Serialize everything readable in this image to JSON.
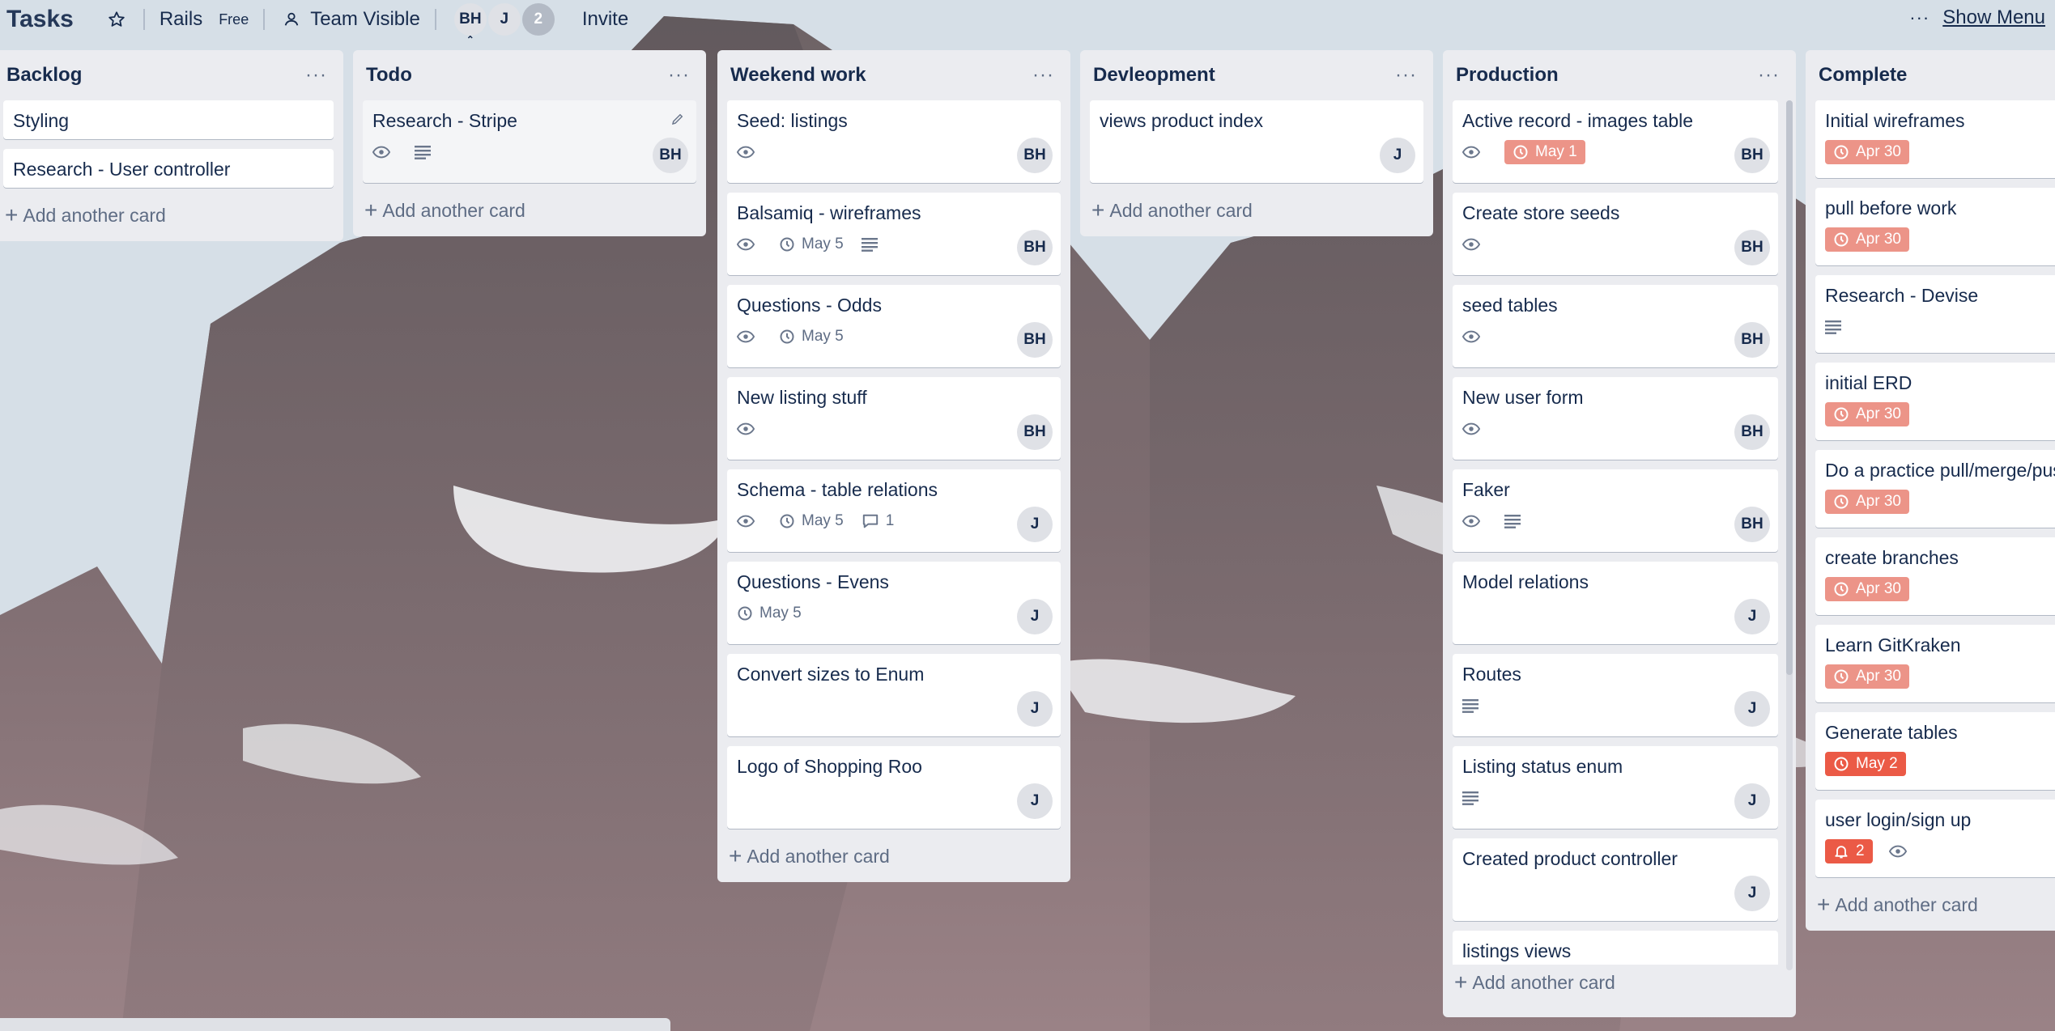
{
  "header": {
    "board_title": "Tasks",
    "team_name": "Rails",
    "team_plan": "Free",
    "visibility": "Team Visible",
    "members": [
      "BH",
      "J"
    ],
    "members_more": "2",
    "invite_label": "Invite",
    "show_menu_label": "Show Menu"
  },
  "lists": [
    {
      "title": "Backlog",
      "cards": [
        {
          "title": "Styling"
        },
        {
          "title": "Research - User controller"
        }
      ],
      "add_label": "Add another card"
    },
    {
      "title": "Todo",
      "cards": [
        {
          "title": "Research - Stripe",
          "watch": true,
          "description": true,
          "member": "BH"
        }
      ],
      "add_label": "Add another card"
    },
    {
      "title": "Weekend work",
      "cards": [
        {
          "title": "Seed: listings",
          "watch": true,
          "member": "BH"
        },
        {
          "title": "Balsamiq - wireframes",
          "watch": true,
          "due": "May 5",
          "description": true,
          "member": "BH"
        },
        {
          "title": "Questions - Odds",
          "watch": true,
          "due": "May 5",
          "member": "BH"
        },
        {
          "title": "New listing stuff",
          "watch": true,
          "member": "BH"
        },
        {
          "title": "Schema - table relations",
          "watch": true,
          "due": "May 5",
          "comments": "1",
          "member": "J"
        },
        {
          "title": "Questions - Evens",
          "due": "May 5",
          "member": "J"
        },
        {
          "title": "Convert sizes to Enum",
          "member": "J"
        },
        {
          "title": "Logo of Shopping Roo",
          "member": "J"
        }
      ],
      "add_label": "Add another card"
    },
    {
      "title": "Devleopment",
      "cards": [
        {
          "title": "views product index",
          "member": "J"
        }
      ],
      "add_label": "Add another card"
    },
    {
      "title": "Production",
      "cards": [
        {
          "title": "Active record - images table",
          "watch": true,
          "due_badge": "May 1",
          "member": "BH"
        },
        {
          "title": "Create store seeds",
          "watch": true,
          "member": "BH"
        },
        {
          "title": "seed tables",
          "watch": true,
          "member": "BH"
        },
        {
          "title": "New user form",
          "watch": true,
          "member": "BH"
        },
        {
          "title": "Faker",
          "watch": true,
          "description": true,
          "member": "BH"
        },
        {
          "title": "Model relations",
          "member": "J"
        },
        {
          "title": "Routes",
          "description": true,
          "member": "J"
        },
        {
          "title": "Listing status enum",
          "description": true,
          "member": "J"
        },
        {
          "title": "Created product controller",
          "member": "J"
        },
        {
          "title": "listings views"
        }
      ],
      "add_label": "Add another card"
    },
    {
      "title": "Complete",
      "cards": [
        {
          "title": "Initial wireframes",
          "due_badge": "Apr 30"
        },
        {
          "title": "pull before work",
          "due_badge": "Apr 30"
        },
        {
          "title": "Research - Devise",
          "description": true
        },
        {
          "title": "initial ERD",
          "due_badge": "Apr 30"
        },
        {
          "title": "Do a practice pull/merge/push",
          "due_badge": "Apr 30"
        },
        {
          "title": "create branches",
          "due_badge": "Apr 30"
        },
        {
          "title": "Learn GitKraken",
          "due_badge": "Apr 30"
        },
        {
          "title": "Generate tables",
          "due_badge_over": "May 2"
        },
        {
          "title": "user login/sign up",
          "notifications": "2",
          "watch": true
        }
      ],
      "add_label": "Add another card"
    }
  ],
  "colors": {
    "list_bg": "#ebecf0",
    "due_soon": "#ec9488",
    "due_overdue": "#eb5a46",
    "text": "#172b4d"
  }
}
